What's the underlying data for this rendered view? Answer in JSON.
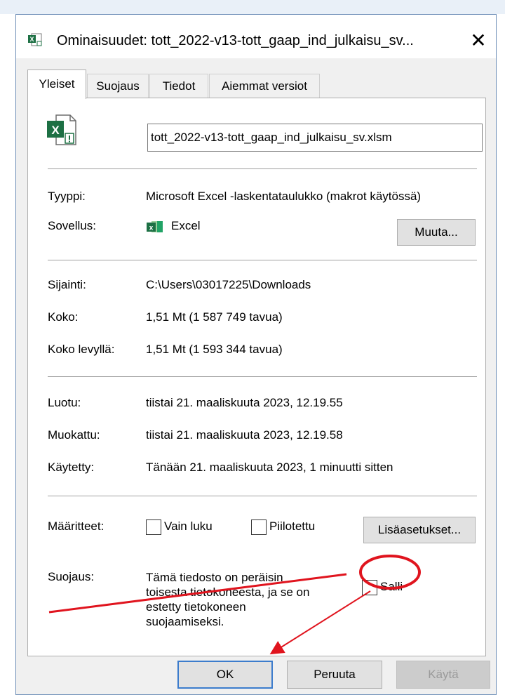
{
  "dialog": {
    "title": "Ominaisuudet: tott_2022-v13-tott_gaap_ind_julkaisu_sv...",
    "close_glyph": "✕"
  },
  "tabs": [
    {
      "label": "Yleiset",
      "active": true
    },
    {
      "label": "Suojaus",
      "active": false
    },
    {
      "label": "Tiedot",
      "active": false
    },
    {
      "label": "Aiemmat versiot",
      "active": false
    }
  ],
  "general": {
    "filename": "tott_2022-v13-tott_gaap_ind_julkaisu_sv.xlsm",
    "type_label": "Tyyppi:",
    "type_value": "Microsoft Excel -laskentataulukko (makrot käytössä)",
    "app_label": "Sovellus:",
    "app_value": "Excel",
    "change_button": "Muuta...",
    "location_label": "Sijainti:",
    "location_value": "C:\\Users\\03017225\\Downloads",
    "size_label": "Koko:",
    "size_value": "1,51 Mt (1 587 749 tavua)",
    "disk_size_label": "Koko levyllä:",
    "disk_size_value": "1,51 Mt (1 593 344 tavua)",
    "created_label": "Luotu:",
    "created_value": "tiistai 21. maaliskuuta 2023, 12.19.55",
    "modified_label": "Muokattu:",
    "modified_value": "tiistai 21. maaliskuuta 2023, 12.19.58",
    "accessed_label": "Käytetty:",
    "accessed_value": "Tänään 21. maaliskuuta 2023, 1 minuutti sitten",
    "attributes_label": "Määritteet:",
    "readonly_label": "Vain luku",
    "readonly_checked": false,
    "hidden_label": "Piilotettu",
    "hidden_checked": false,
    "advanced_button": "Lisäasetukset...",
    "security_label": "Suojaus:",
    "security_text": "Tämä tiedosto on peräisin toisesta tietokoneesta, ja se on estetty tietokoneen suojaamiseksi.",
    "allow_label": "Salli",
    "allow_checked": false
  },
  "buttons": {
    "ok": "OK",
    "cancel": "Peruuta",
    "apply": "Käytä"
  },
  "icons": {
    "title_icon": "excel-file-icon",
    "file_icon": "excel-blocked-file-icon",
    "app_icon": "excel-app-icon",
    "close_icon": "close-icon"
  },
  "colors": {
    "excel_green": "#1d7044",
    "annotation_red": "#e0141e",
    "default_button_border": "#3c7ccc"
  }
}
